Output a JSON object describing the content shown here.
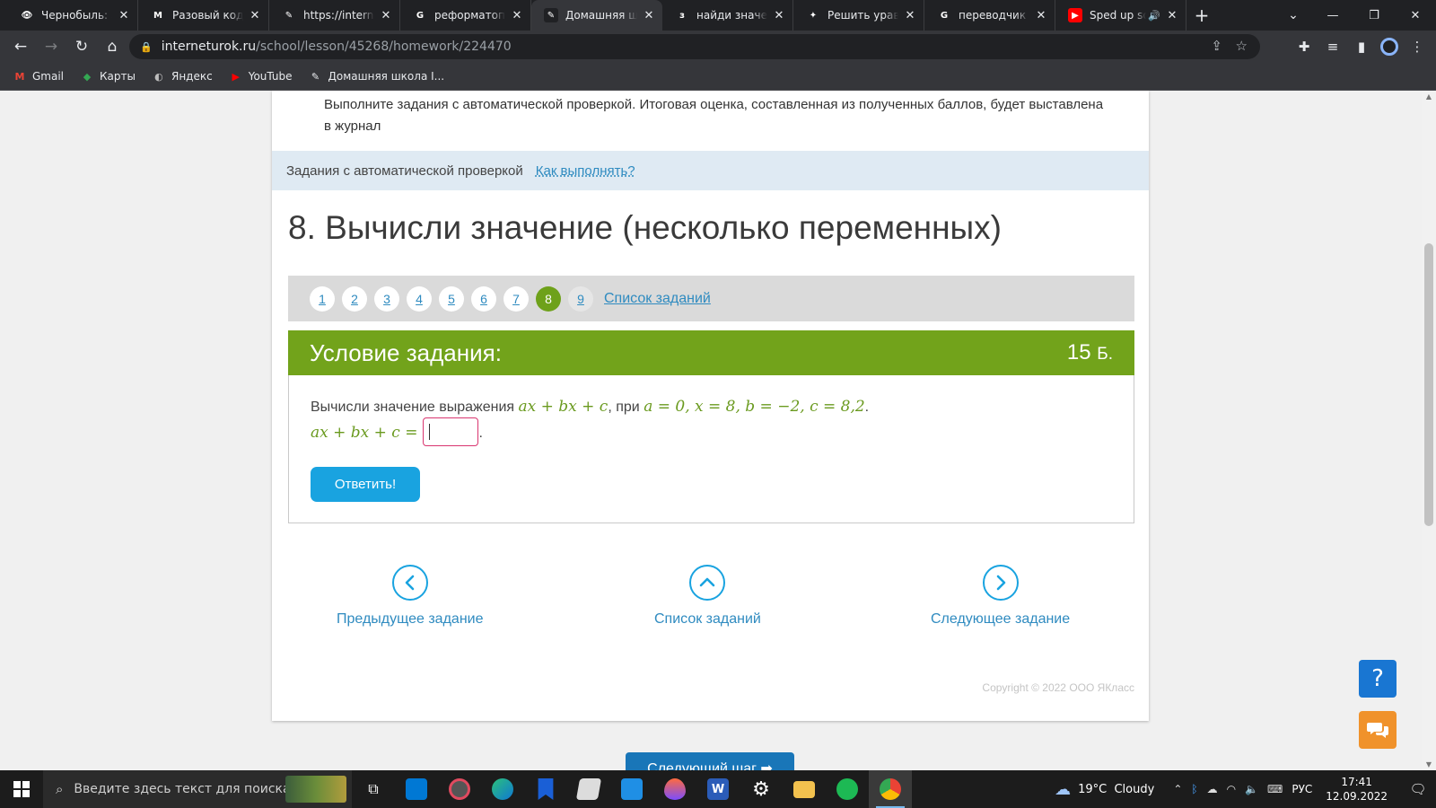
{
  "browser": {
    "tabs": [
      {
        "title": "Чернобыль: Зона",
        "fav_color": "#202124",
        "fav_glyph": "👁",
        "active": false
      },
      {
        "title": "Разовый код - Gmail",
        "fav_color": "#202124",
        "fav_glyph": "M",
        "active": false
      },
      {
        "title": "https://interneturok",
        "fav_color": "#202124",
        "fav_glyph": "✎",
        "active": false
      },
      {
        "title": "реформатоп - Google",
        "fav_color": "#202124",
        "fav_glyph": "G",
        "active": false
      },
      {
        "title": "Домашняя школа",
        "fav_color": "#202124",
        "fav_glyph": "✎",
        "active": true
      },
      {
        "title": "найди значение",
        "fav_color": "#202124",
        "fav_glyph": "з",
        "active": false
      },
      {
        "title": "Решить уравнение",
        "fav_color": "#202124",
        "fav_glyph": "✦",
        "active": false
      },
      {
        "title": "переводчик - Google",
        "fav_color": "#202124",
        "fav_glyph": "G",
        "active": false
      },
      {
        "title": "Sped up song",
        "fav_color": "#ff0000",
        "fav_glyph": "▶",
        "active": false
      }
    ],
    "url_host": "interneturok.ru",
    "url_path": "/school/lesson/45268/homework/224470",
    "bookmarks": [
      {
        "label": "Gmail",
        "icon": "gmail-icon",
        "glyph": "M",
        "color": "#ea4335"
      },
      {
        "label": "Карты",
        "icon": "maps-icon",
        "glyph": "◆",
        "color": "#34a853"
      },
      {
        "label": "Яндекс",
        "icon": "yandex-icon",
        "glyph": "◐",
        "color": "#bdbdbd"
      },
      {
        "label": "YouTube",
        "icon": "youtube-icon",
        "glyph": "▶",
        "color": "#ff0000"
      },
      {
        "label": "Домашняя школа I...",
        "icon": "school-icon",
        "glyph": "✎",
        "color": "#e8eaed"
      }
    ]
  },
  "page": {
    "intro_text": "Выполните задания с автоматической проверкой. Итоговая оценка, составленная из полученных баллов, будет выставлена в журнал",
    "auto_check_label": "Задания с автоматической проверкой",
    "how_to_link": "Как выполнять?",
    "task_title": "8. Вычисли значение (несколько переменных)",
    "pager": {
      "pages": [
        "1",
        "2",
        "3",
        "4",
        "5",
        "6",
        "7",
        "8",
        "9"
      ],
      "active": "8",
      "list_link": "Список заданий"
    },
    "condition": {
      "header": "Условие задания:",
      "points": "15",
      "points_unit": "Б.",
      "line1_prefix": "Вычисли значение выражения ",
      "expression": "ax + bx + c",
      "line1_mid": ", при ",
      "values": "a = 0, x = 8, b = −2, c = 8,2",
      "line1_end": ".",
      "line2_lhs": "ax + bx + c =",
      "line2_end": ".",
      "answer_value": "",
      "answer_button": "Ответить!"
    },
    "nav": {
      "prev": "Предыдущее задание",
      "list": "Список заданий",
      "next": "Следующее задание"
    },
    "copyright": "Copyright © 2022 ООО ЯКласс",
    "next_step": "Следующий шаг ➡",
    "colors": {
      "accent_green": "#72a31b",
      "link_blue": "#2f8bc0",
      "button_blue": "#19a3e0"
    }
  },
  "taskbar": {
    "search_placeholder": "Введите здесь текст для поиска",
    "weather": "19°C  Cloudy",
    "lang": "РУС",
    "time": "17:41",
    "date": "12.09.2022"
  }
}
